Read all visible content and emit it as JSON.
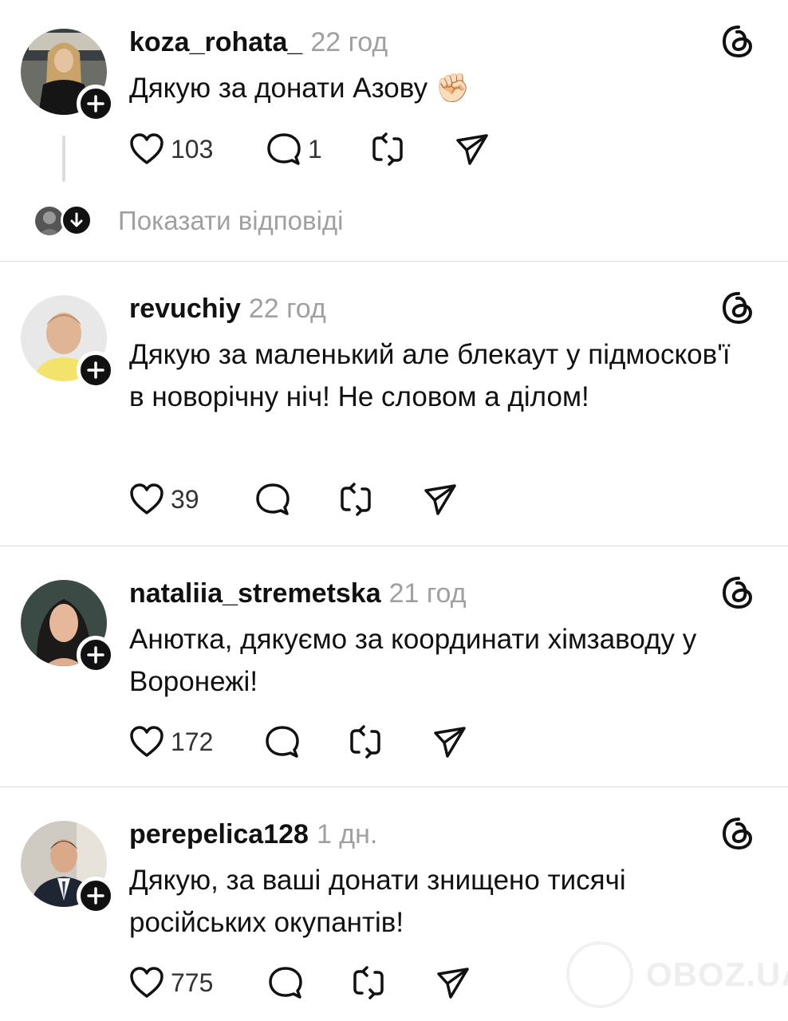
{
  "posts": [
    {
      "username": "koza_rohata_",
      "time": "22 год",
      "text": "Дякую за донати Азову ✊🏻",
      "likes": "103",
      "comments": "1",
      "show_replies": "Показати відповіді"
    },
    {
      "username": "revuchiy",
      "time": "22 год",
      "text": "Дякую за маленький але блекаут у підмосков'ї в новорічну ніч! Не словом а ділом!",
      "likes": "39"
    },
    {
      "username": "nataliia_stremetska",
      "time": "21 год",
      "text": "Анютка, дякуємо за координати хімзаводу у Воронежі!",
      "likes": "172"
    },
    {
      "username": "perepelica128",
      "time": "1 дн.",
      "text": "Дякую, за ваші донати знищено тисячі російських окупантів!",
      "likes": "775"
    }
  ],
  "watermark": "OBOZ.UA",
  "icons": [
    "heart-icon",
    "comment-icon",
    "repost-icon",
    "share-icon",
    "threads-icon",
    "plus-icon",
    "chevron-down-icon"
  ]
}
